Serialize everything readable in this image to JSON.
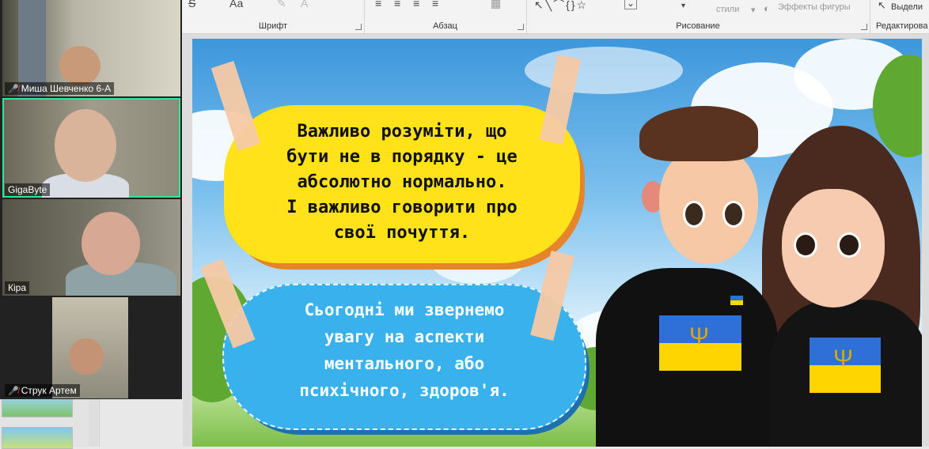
{
  "ribbon": {
    "groups": [
      {
        "label": "Шрифт"
      },
      {
        "label": "Абзац"
      },
      {
        "label": "Рисование"
      },
      {
        "label": "Редактирова"
      }
    ],
    "font_icons": [
      "A",
      "S",
      "Аа",
      "A"
    ],
    "drawing": {
      "styles_label": "стили",
      "effects_label": "Эффекты фигуры"
    },
    "editing": {
      "select_label": "Выдели"
    }
  },
  "participants": [
    {
      "name": "Миша Шевченко 6-А",
      "muted": true,
      "active": false
    },
    {
      "name": "GigaByte",
      "muted": false,
      "active": true
    },
    {
      "name": "Кіра",
      "muted": false,
      "active": false
    },
    {
      "name": "Струк Артем",
      "muted": true,
      "active": false
    }
  ],
  "slide": {
    "yellow_text": [
      "Важливо розуміти, що",
      "бути не в порядку - це",
      "абсолютно нормально.",
      "І важливо говорити про",
      "свої почуття."
    ],
    "blue_text": [
      "Сьогодні ми звернемо",
      "увагу на аспекти",
      "ментального, або",
      "психічного, здоров'я."
    ],
    "colors": {
      "yellow_bubble": "#ffe21a",
      "blue_bubble": "#39b1ec",
      "flag_blue": "#2f6fd8",
      "flag_yellow": "#ffd500"
    }
  }
}
